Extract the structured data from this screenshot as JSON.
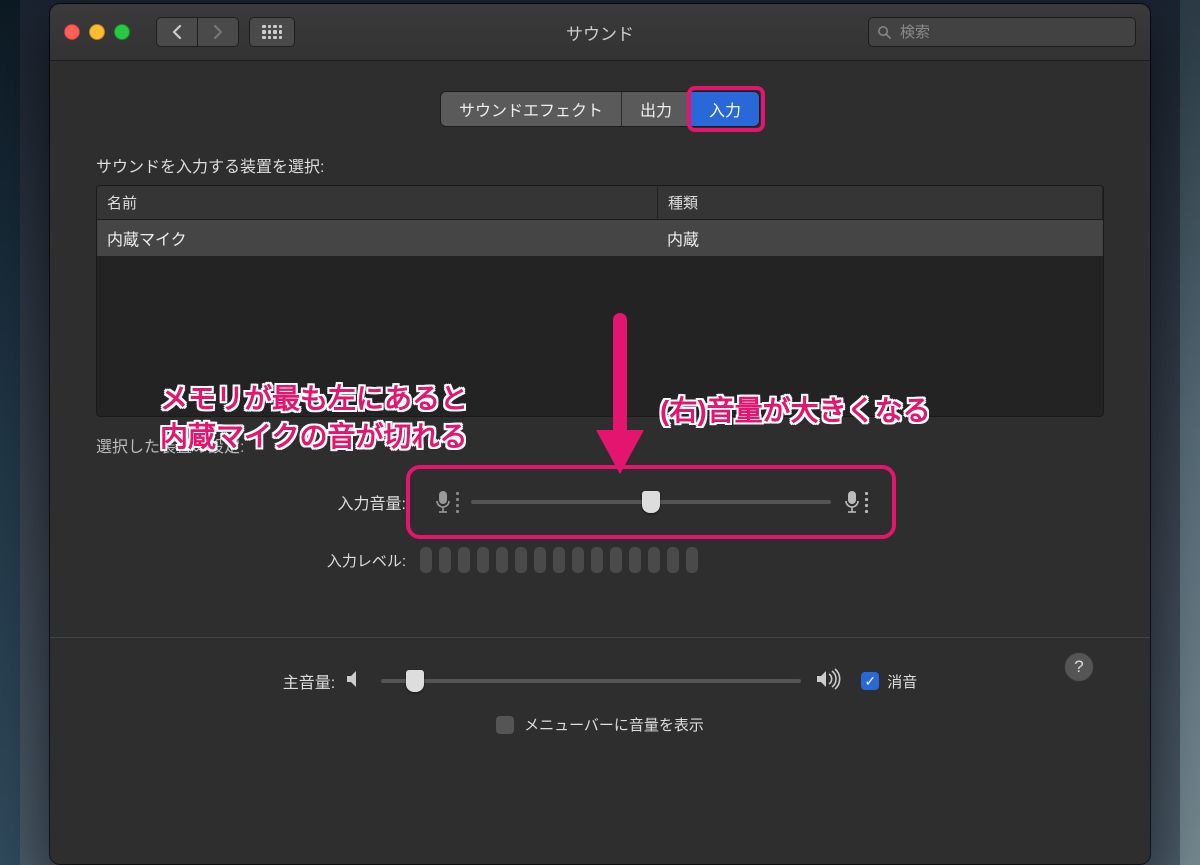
{
  "window": {
    "title": "サウンド"
  },
  "search": {
    "placeholder": "検索"
  },
  "tabs": {
    "effects": "サウンドエフェクト",
    "output": "出力",
    "input": "入力"
  },
  "input_section": {
    "choose_label": "サウンドを入力する装置を選択:",
    "col_name": "名前",
    "col_type": "種類",
    "row_name": "内蔵マイク",
    "row_type": "内蔵",
    "settings_label": "選択した装置の設定:",
    "volume_label": "入力音量:",
    "level_label": "入力レベル:",
    "slider_percent": 50,
    "level_segments": 15
  },
  "main_volume": {
    "label": "主音量:",
    "slider_percent": 8,
    "mute_label": "消音",
    "mute_checked": true,
    "menubar_label": "メニューバーに音量を表示",
    "menubar_checked": false
  },
  "annotations": {
    "left_line1": "メモリが最も左にあると",
    "left_line2": "内蔵マイクの音が切れる",
    "right": "(右)音量が大きくなる"
  }
}
